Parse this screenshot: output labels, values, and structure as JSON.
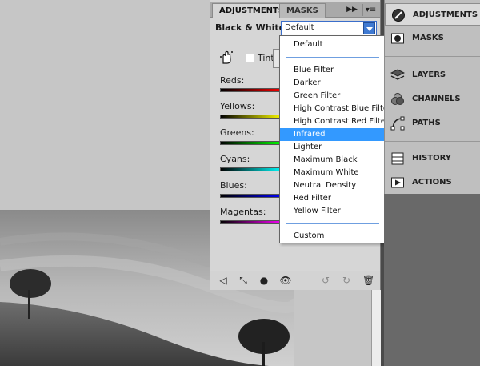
{
  "panel": {
    "tabs": [
      "ADJUSTMENTS",
      "MASKS"
    ],
    "title": "Black & White",
    "preset_value": "Default",
    "tint_label": "Tint"
  },
  "sliders": [
    {
      "label": "Reds:",
      "color": "#ff0000"
    },
    {
      "label": "Yellows:",
      "color": "#ffff00"
    },
    {
      "label": "Greens:",
      "color": "#00ff00"
    },
    {
      "label": "Cyans:",
      "color": "#00ffff"
    },
    {
      "label": "Blues:",
      "color": "#0000ff"
    },
    {
      "label": "Magentas:",
      "color": "#ff00ff"
    }
  ],
  "preset_list": {
    "options": [
      "Default",
      "Blue Filter",
      "Darker",
      "Green Filter",
      "High Contrast Blue Filter",
      "High Contrast Red Filter",
      "Infrared",
      "Lighter",
      "Maximum Black",
      "Maximum White",
      "Neutral Density",
      "Red Filter",
      "Yellow Filter",
      "Custom"
    ],
    "selected": "Infrared",
    "selection_color": "#3399ff"
  },
  "dock": {
    "items": [
      "ADJUSTMENTS",
      "MASKS",
      "LAYERS",
      "CHANNELS",
      "PATHS",
      "HISTORY",
      "ACTIONS"
    ]
  }
}
